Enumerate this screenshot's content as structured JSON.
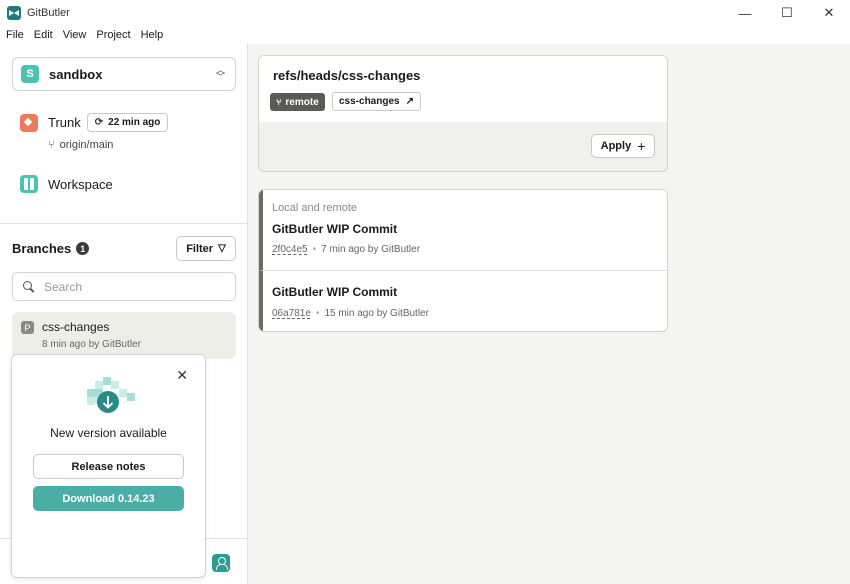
{
  "app": {
    "title": "GitButler"
  },
  "window_controls": {
    "minimize": "—",
    "maximize": "☐",
    "close": "✕"
  },
  "menu": [
    "File",
    "Edit",
    "View",
    "Project",
    "Help"
  ],
  "project": {
    "initial": "S",
    "name": "sandbox",
    "accent": "#4cc2b0"
  },
  "trunk": {
    "label": "Trunk",
    "badge": "22 min ago",
    "origin": "origin/main"
  },
  "workspace": {
    "label": "Workspace"
  },
  "branches": {
    "title": "Branches",
    "count": "1",
    "filter_label": "Filter",
    "search_placeholder": "Search",
    "items": [
      {
        "icon": "P",
        "name": "css-changes",
        "meta": "8 min ago by GitButler"
      }
    ]
  },
  "update": {
    "title": "New version available",
    "release_notes": "Release notes",
    "download": "Download 0.14.23",
    "accent": "#4aada6"
  },
  "branch_header": {
    "ref": "refs/heads/css-changes",
    "remote_tag": "remote",
    "branch_tag": "css-changes",
    "apply": "Apply"
  },
  "commits": {
    "section_label": "Local and remote",
    "items": [
      {
        "title": "GitButler WIP Commit",
        "hash": "2f0c4e5",
        "meta": "7 min ago by GitButler"
      },
      {
        "title": "GitButler WIP Commit",
        "hash": "06a781e",
        "meta": "15 min ago by GitButler"
      }
    ]
  }
}
